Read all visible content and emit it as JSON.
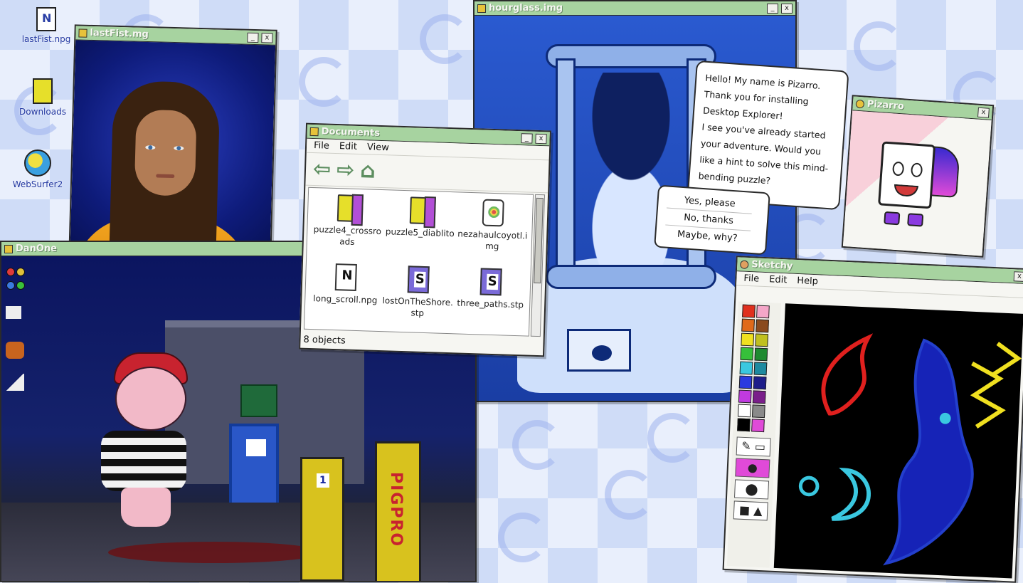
{
  "desktop": {
    "icons": [
      {
        "label": "lastFist.npg",
        "icon": "notepad-icon"
      },
      {
        "label": "Downloads",
        "icon": "folder-icon"
      },
      {
        "label": "WebSurfer2",
        "icon": "globe-icon"
      }
    ]
  },
  "windows": {
    "portrait": {
      "title": "lastFist.mg",
      "minimize": "_",
      "close": "x"
    },
    "game": {
      "title": "DanOne",
      "minimize": "_",
      "close": "x"
    },
    "documents": {
      "title": "Documents",
      "menu": [
        "File",
        "Edit",
        "View"
      ],
      "toolbar": {
        "back": "⇦",
        "forward": "⇨",
        "home": "⌂"
      },
      "items": [
        {
          "label": "puzzle4_crossroads",
          "type": "folder"
        },
        {
          "label": "puzzle5_diablito",
          "type": "folder"
        },
        {
          "label": "nezahaulcoyotl.img",
          "type": "img"
        },
        {
          "label": "long_scroll.npg",
          "type": "note"
        },
        {
          "label": "lostOnTheShore.stp",
          "type": "book"
        },
        {
          "label": "three_paths.stp",
          "type": "book"
        }
      ],
      "status": "8 objects",
      "minimize": "_",
      "close": "x"
    },
    "hourglass": {
      "title": "hourglass.img",
      "minimize": "_",
      "close": "x"
    },
    "pizarro": {
      "title": "Pizarro",
      "close": "x"
    },
    "sketchy": {
      "title": "Sketchy",
      "menu": [
        "File",
        "Edit",
        "Help"
      ],
      "close": "x",
      "palette": [
        "#e0301e",
        "#f4a6c8",
        "#e06a1a",
        "#8a4a1e",
        "#f0e020",
        "#c0c020",
        "#36c03a",
        "#1e8a30",
        "#3ac8e0",
        "#1e8aa0",
        "#2a3ae0",
        "#1e1e8a",
        "#c03ae0",
        "#7a1e8a",
        "#ffffff",
        "#8a8a8a",
        "#000000",
        "#e04ad8"
      ]
    }
  },
  "pizarro_dialog": {
    "message_lines": [
      "Hello! My name is Pizarro.",
      "Thank you for installing",
      "Desktop Explorer!",
      "I see you've already started",
      "your adventure. Would you",
      "like a hint to solve this mind-",
      "bending puzzle?"
    ],
    "choices": [
      "Yes, please",
      "No, thanks",
      "Maybe, why?"
    ]
  },
  "game_scene": {
    "machine_label": "PIGPRO",
    "machine_number": "1"
  }
}
